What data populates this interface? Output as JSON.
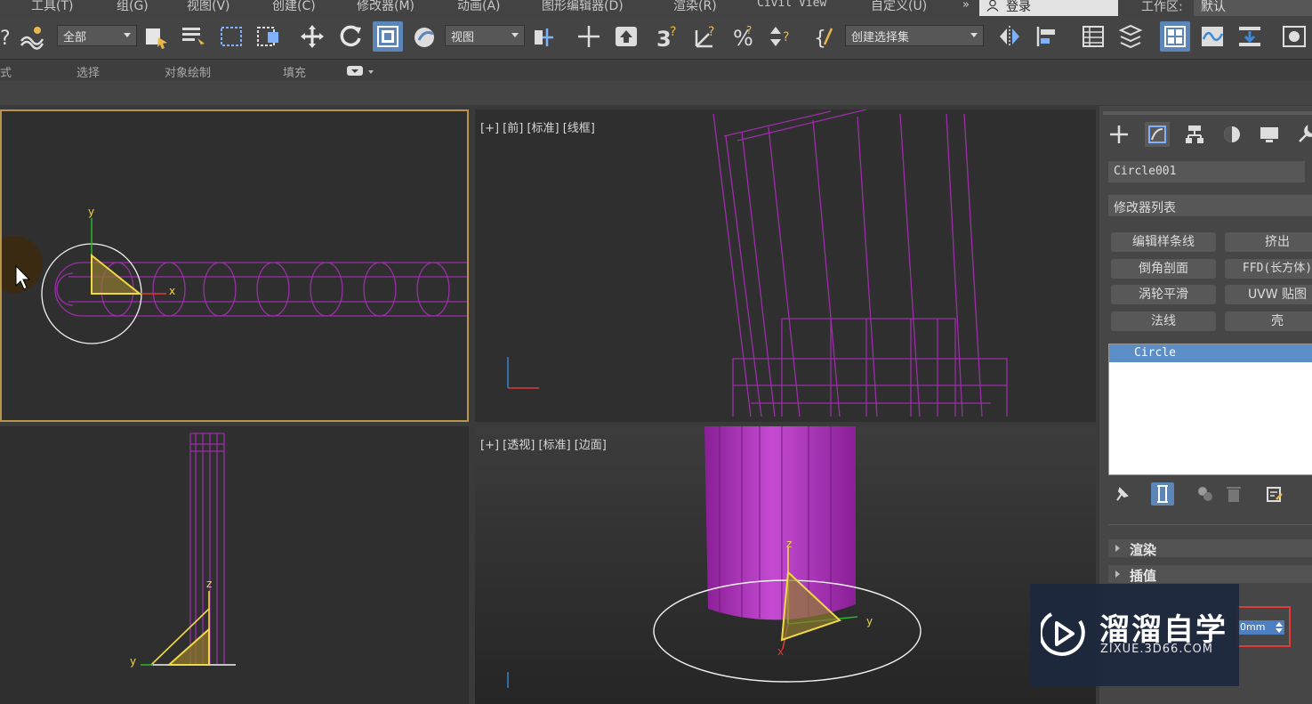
{
  "menubar": {
    "items": [
      "工具(T)",
      "组(G)",
      "视图(V)",
      "创建(C)",
      "修改器(M)",
      "动画(A)",
      "图形编辑器(D)",
      "渲染(R)",
      "Civil View",
      "自定义(U)"
    ],
    "more": "»",
    "login_label": "登录",
    "workspace_label": "工作区:",
    "workspace_value": "默认"
  },
  "toolbar": {
    "filter_value": "全部",
    "coord_value": "视图",
    "named_selection_value": "创建选择集"
  },
  "ribbon": {
    "tabs": [
      "式",
      "选择",
      "对象绘制",
      "填充"
    ]
  },
  "viewports": {
    "top_right_label": "[+] [前] [标准] [线框]",
    "bottom_right_label": "[+] [透视] [标准] [边面]",
    "axis_labels": {
      "x": "x",
      "y": "y",
      "z": "z"
    }
  },
  "command_panel": {
    "object_name": "Circle001",
    "modifier_list_label": "修改器列表",
    "modifier_buttons": [
      "编辑样条线",
      "挤出",
      "倒角剖面",
      "FFD(长方体)",
      "涡轮平滑",
      "UVW 贴图",
      "法线",
      "壳"
    ],
    "stack_items": [
      "Circle"
    ],
    "rollouts": [
      "渲染",
      "插值"
    ],
    "spinner_value": "0mm"
  },
  "watermark": {
    "title": "溜溜自学",
    "subtitle": "ZIXUE.3D66.COM"
  },
  "colors": {
    "menubar_bg": "#434343",
    "viewport_bg": "#2f2f2f",
    "active_viewport_border": "#b89548",
    "accent_blue": "#5c86b8",
    "object_purple": "#9b2ea8",
    "highlight_red": "#e03a3a"
  }
}
